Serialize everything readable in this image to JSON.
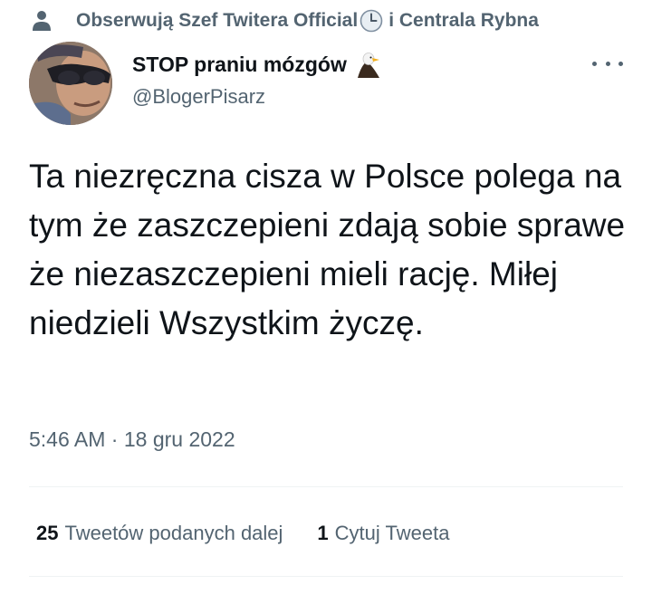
{
  "social_context": {
    "prefix": "Obserwują Szef Twitera Official",
    "suffix": " i Centrala Rybna",
    "icon": "person-icon",
    "emoji_icon": "clock-icon"
  },
  "author": {
    "display_name": "STOP praniu mózgów",
    "handle": "@BlogerPisarz",
    "name_emoji": "eagle-icon",
    "avatar": "avatar"
  },
  "tweet": {
    "text": "Ta niezręczna cisza w Polsce polega na tym że zaszczepieni zdają sobie sprawe że niezaszczepieni mieli rację. Miłej niedzieli Wszystkim życzę.",
    "time": "5:46 AM",
    "separator": " · ",
    "date": "18 gru 2022"
  },
  "stats": {
    "retweets_count": "25",
    "retweets_label": "Tweetów podanych dalej",
    "quotes_count": "1",
    "quotes_label": "Cytuj Tweeta"
  },
  "colors": {
    "text_primary": "#0f1419",
    "text_secondary": "#536471",
    "divider": "#eff3f4"
  }
}
